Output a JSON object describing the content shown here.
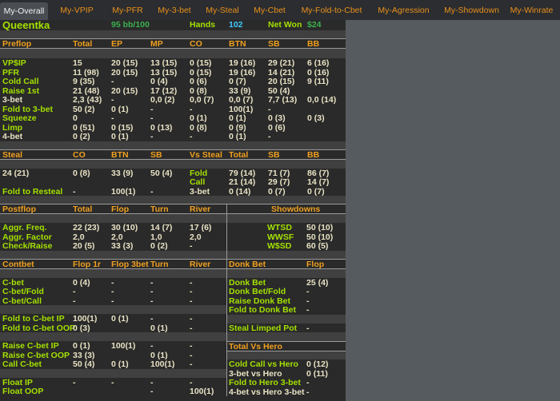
{
  "tabs": [
    "My-Overall",
    "My-VPIP",
    "My-PFR",
    "My-3-bet",
    "My-Steal",
    "My-Cbet",
    "My-Fold-to-Cbet",
    "My-Agression",
    "My-Showdown",
    "My-Winrate"
  ],
  "active_tab": "My-Overall",
  "player": {
    "name": "Queentka",
    "winrate": "95 bb/100",
    "hands_label": "Hands",
    "hands": "102",
    "net_won_label": "Net Won",
    "net_won": "$24"
  },
  "colors": {
    "header": "#f0a020",
    "label": "#a4e000",
    "value": "#e8e2c4",
    "hands": "#40c8ff",
    "winrate": "#3cb050"
  },
  "preflop": {
    "headers": [
      "Preflop",
      "Total",
      "EP",
      "MP",
      "CO",
      "BTN",
      "SB",
      "BB"
    ],
    "rows": [
      [
        "VP$IP",
        "15",
        "20 (15)",
        "13 (15)",
        "0 (15)",
        "19 (16)",
        "29 (21)",
        "6 (16)"
      ],
      [
        "PFR",
        "11 (98)",
        "20 (15)",
        "13 (15)",
        "0 (15)",
        "19 (16)",
        "14 (21)",
        "0 (16)"
      ],
      [
        "Cold Call",
        "9 (35)",
        "-",
        "0 (4)",
        "0 (6)",
        "0 (7)",
        "20 (15)",
        "9 (11)"
      ],
      [
        "Raise 1st",
        "21 (48)",
        "20 (15)",
        "17 (12)",
        "0 (8)",
        "33 (9)",
        "50 (4)",
        ""
      ],
      [
        "3-bet",
        "2,3 (43)",
        "-",
        "0,0 (2)",
        "0,0 (7)",
        "0,0 (7)",
        "7,7 (13)",
        "0,0 (14)"
      ],
      [
        "Fold to 3-bet",
        "50 (2)",
        "0 (1)",
        "-",
        "-",
        "100(1)",
        "-",
        ""
      ],
      [
        "Squeeze",
        "0",
        "-",
        "-",
        "0 (1)",
        "0 (1)",
        "0 (3)",
        "0 (3)"
      ],
      [
        "Limp",
        "0 (51)",
        "0 (15)",
        "0 (13)",
        "0 (8)",
        "0 (9)",
        "0 (6)",
        ""
      ],
      [
        "4-bet",
        "0 (2)",
        "0 (1)",
        "-",
        "-",
        "0 (1)",
        "-",
        ""
      ]
    ]
  },
  "steal": {
    "headers": [
      "Steal",
      "CO",
      "BTN",
      "SB",
      "Vs Steal",
      "Total",
      "SB",
      "BB"
    ],
    "rows": [
      [
        "24 (21)",
        "0 (8)",
        "33 (9)",
        "50 (4)",
        "Fold",
        "79 (14)",
        "71 (7)",
        "86 (7)"
      ],
      [
        "",
        "",
        "",
        "",
        "Call",
        "21 (14)",
        "29 (7)",
        "14 (7)"
      ],
      [
        "Fold to Resteal",
        "-",
        "100(1)",
        "-",
        "3-bet",
        "0 (14)",
        "0 (7)",
        "0 (7)"
      ]
    ]
  },
  "postflop": {
    "headers": [
      "Postflop",
      "Total",
      "Flop",
      "Turn",
      "River"
    ],
    "rows": [
      [
        "Aggr. Freq.",
        "22 (23)",
        "30 (10)",
        "14 (7)",
        "17 (6)"
      ],
      [
        "Aggr. Factor",
        "2,0",
        "2,0",
        "1,0",
        "2,0"
      ],
      [
        "Check/Raise",
        "20 (5)",
        "33 (3)",
        "0 (2)",
        "-"
      ]
    ]
  },
  "showdowns": {
    "header": "Showdowns",
    "rows": [
      [
        "WTSD",
        "50 (10)"
      ],
      [
        "WWSF",
        "50 (10)"
      ],
      [
        "W$SD",
        "60 (5)"
      ]
    ]
  },
  "contbet": {
    "headers": [
      "Contbet",
      "Flop 1r",
      "Flop 3bet",
      "Turn",
      "River"
    ],
    "groups": [
      [
        [
          "C-bet",
          "0 (4)",
          "-",
          "-",
          "-"
        ],
        [
          "C-bet/Fold",
          "-",
          "-",
          "-",
          "-"
        ],
        [
          "C-bet/Call",
          "-",
          "-",
          "-",
          "-"
        ]
      ],
      [
        [
          "Fold to C-bet IP",
          "100(1)",
          "0 (1)",
          "-",
          "-"
        ],
        [
          "Fold to C-bet OOP",
          "0 (3)",
          "",
          "0 (1)",
          "-"
        ]
      ],
      [
        [
          "Raise C-bet IP",
          "0 (1)",
          "100(1)",
          "-",
          "-"
        ],
        [
          "Raise C-bet OOP",
          "33 (3)",
          "",
          "0 (1)",
          "-"
        ],
        [
          "Call C-bet",
          "50 (4)",
          "0 (1)",
          "100(1)",
          "-"
        ]
      ],
      [
        [
          "Float IP",
          "-",
          "-",
          "-",
          "-"
        ],
        [
          "Float OOP",
          "",
          "",
          "-",
          "100(1)"
        ]
      ]
    ]
  },
  "donk": {
    "headers": [
      "Donk Bet",
      "Flop"
    ],
    "rows": [
      [
        "Donk Bet",
        "25 (4)"
      ],
      [
        "Donk Bet/Fold",
        "-"
      ],
      [
        "Raise Donk Bet",
        "-"
      ],
      [
        "Fold to Donk Bet",
        "-"
      ]
    ],
    "steal_limped": [
      "Steal Limped Pot",
      "-"
    ]
  },
  "vs_hero": {
    "header": "Total Vs Hero",
    "rows": [
      [
        "Cold Call vs Hero",
        "0 (12)"
      ],
      [
        "3-bet vs Hero",
        "0 (11)"
      ],
      [
        "Fold to Hero 3-bet",
        "-"
      ],
      [
        "4-bet vs Hero 3-bet",
        "-"
      ]
    ]
  }
}
